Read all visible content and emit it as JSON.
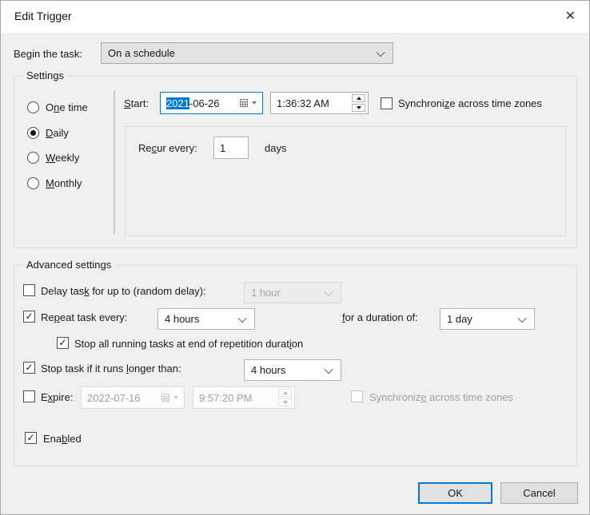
{
  "icons": {
    "close": "✕",
    "check": "✓"
  },
  "colors": {
    "accent": "#0078d7",
    "dialog_bg": "#f0f0f0",
    "titlebar_bg": "#ffffff"
  },
  "window": {
    "title": "Edit Trigger"
  },
  "begin_task": {
    "label": {
      "text": "Begin the task:",
      "underline": 2
    },
    "value": "On a schedule"
  },
  "settings": {
    "group_label": "Settings",
    "radios": [
      {
        "label": {
          "text": "One time",
          "underline": 1
        },
        "checked": false
      },
      {
        "label": {
          "text": "Daily",
          "underline": 0
        },
        "checked": true
      },
      {
        "label": {
          "text": "Weekly",
          "underline": 0
        },
        "checked": false
      },
      {
        "label": {
          "text": "Monthly",
          "underline": 0
        },
        "checked": false
      }
    ],
    "start": {
      "label": {
        "text": "Start:",
        "underline": 0
      },
      "date_selected": "2021",
      "date_rest": "-06-26",
      "time": "1:36:32 AM",
      "sync": {
        "label": {
          "text": "Synchronize across time zones",
          "underline": 9
        },
        "checked": false
      }
    },
    "recur": {
      "label": {
        "text": "Recur every:",
        "underline": 2
      },
      "value": "1",
      "unit": "days"
    }
  },
  "advanced": {
    "group_label": "Advanced settings",
    "delay": {
      "label": {
        "text": "Delay task for up to (random delay):",
        "underline": 9
      },
      "checked": false,
      "value": "1 hour"
    },
    "repeat": {
      "label": {
        "text": "Repeat task every:",
        "underline": 2
      },
      "checked": true,
      "value": "4 hours"
    },
    "duration": {
      "label": {
        "text": "for a duration of:",
        "underline": 0
      },
      "value": "1 day"
    },
    "stop_all": {
      "label": {
        "text": "Stop all running tasks at end of repetition duration",
        "underline": 49
      },
      "checked": true
    },
    "stop_task": {
      "label": {
        "text": "Stop task if it runs longer than:",
        "underline": 21
      },
      "checked": true,
      "value": "4 hours"
    },
    "expire": {
      "label": {
        "text": "Expire:",
        "underline": 1
      },
      "checked": false,
      "date": "2022-07-16",
      "time": "9:57:20 PM",
      "sync": {
        "label": {
          "text": "Synchronize across time zones",
          "underline": 10
        },
        "checked": false
      }
    },
    "enabled": {
      "label": {
        "text": "Enabled",
        "underline": 3
      },
      "checked": true
    }
  },
  "buttons": {
    "ok": "OK",
    "cancel": "Cancel"
  }
}
